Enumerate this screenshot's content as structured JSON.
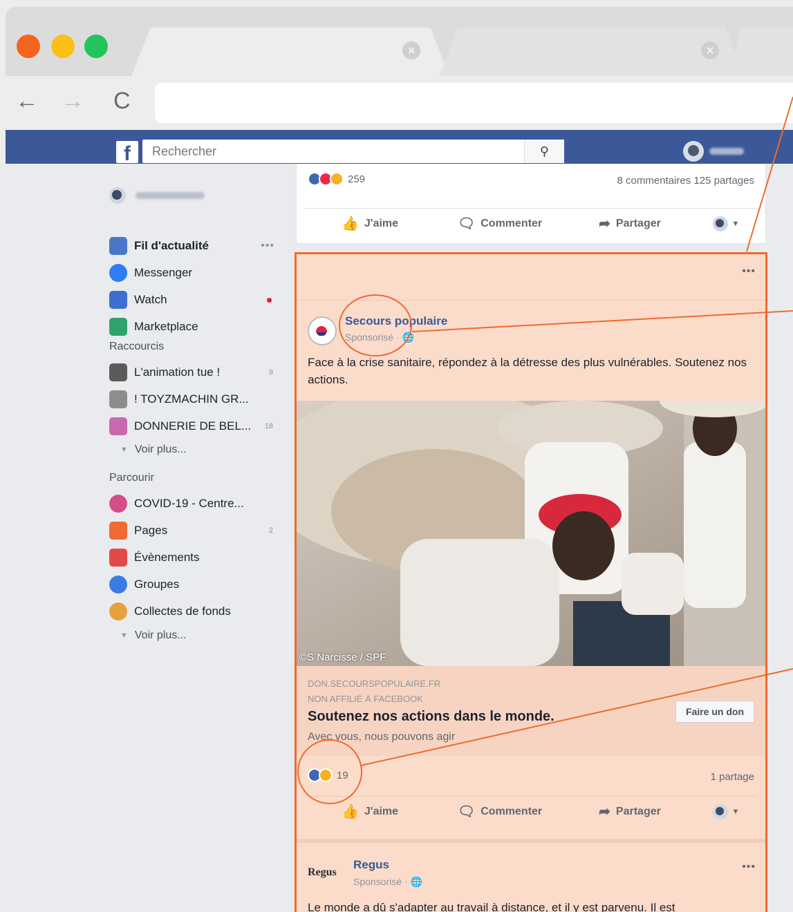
{
  "browser": {
    "tab_close_glyph": "×",
    "nav": {
      "back": "←",
      "forward": "→",
      "reload": "C"
    }
  },
  "header": {
    "logo_letter": "f",
    "search_placeholder": "Rechercher",
    "search_icon": "search-icon"
  },
  "sidebar": {
    "items": [
      {
        "label": "Fil d'actualité",
        "icon": "news-feed-icon",
        "more": "•••",
        "color": "#4a76c9"
      },
      {
        "label": "Messenger",
        "icon": "messenger-icon",
        "color": "#2e7cf6"
      },
      {
        "label": "Watch",
        "icon": "watch-icon",
        "color": "#3d6fd1"
      },
      {
        "label": "Marketplace",
        "icon": "marketplace-icon",
        "color": "#2fa36b"
      }
    ],
    "shortcuts_heading": "Raccourcis",
    "shortcuts": [
      {
        "label": "L'animation tue !",
        "count": "9"
      },
      {
        "label": "! TOYZMACHIN GR...",
        "count": ""
      },
      {
        "label": "DONNERIE DE BEL...",
        "count": "18"
      }
    ],
    "see_more_1": "Voir plus...",
    "explore_heading": "Parcourir",
    "explore": [
      {
        "label": "COVID-19 - Centre...",
        "count": ""
      },
      {
        "label": "Pages",
        "count": "2"
      },
      {
        "label": "Évènements",
        "count": ""
      },
      {
        "label": "Groupes",
        "count": ""
      },
      {
        "label": "Collectes de fonds",
        "count": ""
      }
    ],
    "see_more_2": "Voir plus..."
  },
  "top_post": {
    "reaction_count": "259",
    "comments_shares": "8 commentaires  125 partages",
    "actions": {
      "like": "J'aime",
      "comment": "Commenter",
      "share": "Partager"
    }
  },
  "ad": {
    "more": "•••",
    "page_name": "Secours populaire",
    "sponsored": "Sponsorisé · ",
    "text": "Face à la crise sanitaire, répondez à la détresse des plus vulnérables. Soutenez nos actions.",
    "photo_credit": "©S Narcisse / SPF",
    "domain": "DON.SECOURSPOPULAIRE.FR",
    "not_affiliated": "NON AFFILIÉ À FACEBOOK",
    "headline": "Soutenez nos actions dans le monde.",
    "description": "Avec vous, nous pouvons agir",
    "cta": "Faire un don",
    "reaction_count": "19",
    "shares": "1 partage",
    "actions": {
      "like": "J'aime",
      "comment": "Commenter",
      "share": "Partager"
    }
  },
  "next_post": {
    "logo": "Regus",
    "page_name": "Regus",
    "sponsored": "Sponsorisé · ",
    "more": "•••",
    "text": "Le monde a dû s'adapter au travail à distance, et il y est parvenu. Il est"
  },
  "colors": {
    "fb_blue": "#3b5998",
    "highlight_fill": "#fbdccb",
    "annotation_orange": "#ef6a2c"
  }
}
